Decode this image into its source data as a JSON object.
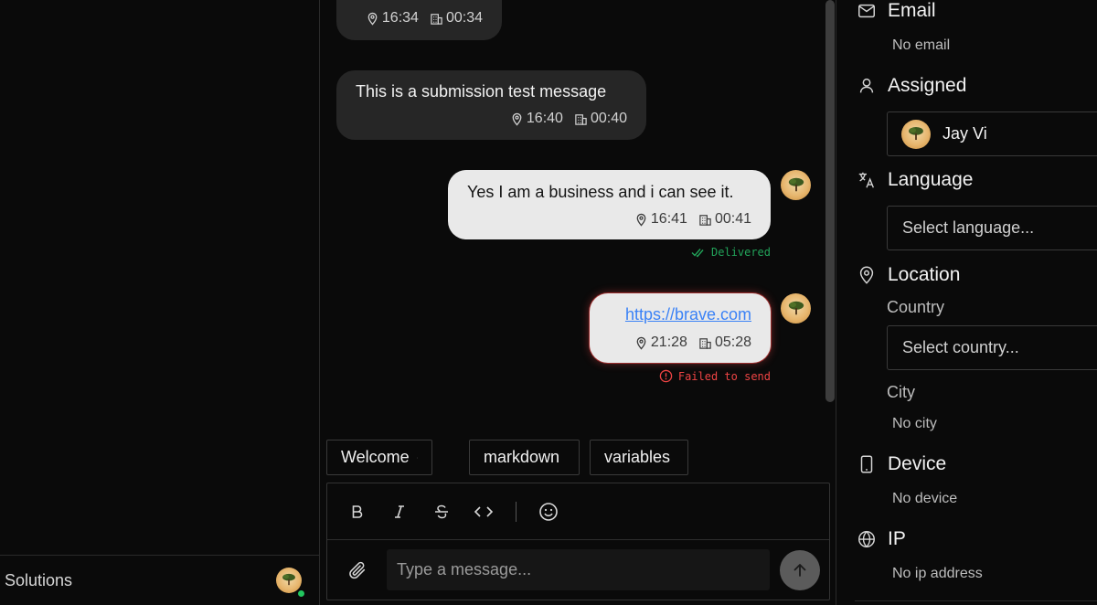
{
  "sidebar": {
    "workspace_name": "Solutions"
  },
  "chat": {
    "messages": [
      {
        "direction": "incoming",
        "text": "",
        "location_time": "16:34",
        "local_time": "00:34"
      },
      {
        "direction": "incoming",
        "text": "This is a submission test message",
        "location_time": "16:40",
        "local_time": "00:40"
      },
      {
        "direction": "outgoing",
        "text": "Yes I am a business and i can see it.",
        "location_time": "16:41",
        "local_time": "00:41",
        "status": "Delivered"
      },
      {
        "direction": "outgoing",
        "text": "https://brave.com",
        "location_time": "21:28",
        "local_time": "05:28",
        "status": "Failed to send"
      }
    ],
    "quick_replies": [
      "Welcome",
      "markdown",
      "variables"
    ],
    "composer": {
      "placeholder": "Type a message..."
    }
  },
  "contact": {
    "email": {
      "label": "Email",
      "value": "No email"
    },
    "assigned": {
      "label": "Assigned",
      "assignee": "Jay Vi"
    },
    "language": {
      "label": "Language",
      "placeholder": "Select language..."
    },
    "location": {
      "label": "Location",
      "country_label": "Country",
      "country_placeholder": "Select country...",
      "city_label": "City",
      "city_value": "No city"
    },
    "device": {
      "label": "Device",
      "value": "No device"
    },
    "ip": {
      "label": "IP",
      "value": "No ip address"
    }
  },
  "colors": {
    "delivered": "#22a35a",
    "failed": "#ef4444",
    "link": "#3b82f6"
  }
}
